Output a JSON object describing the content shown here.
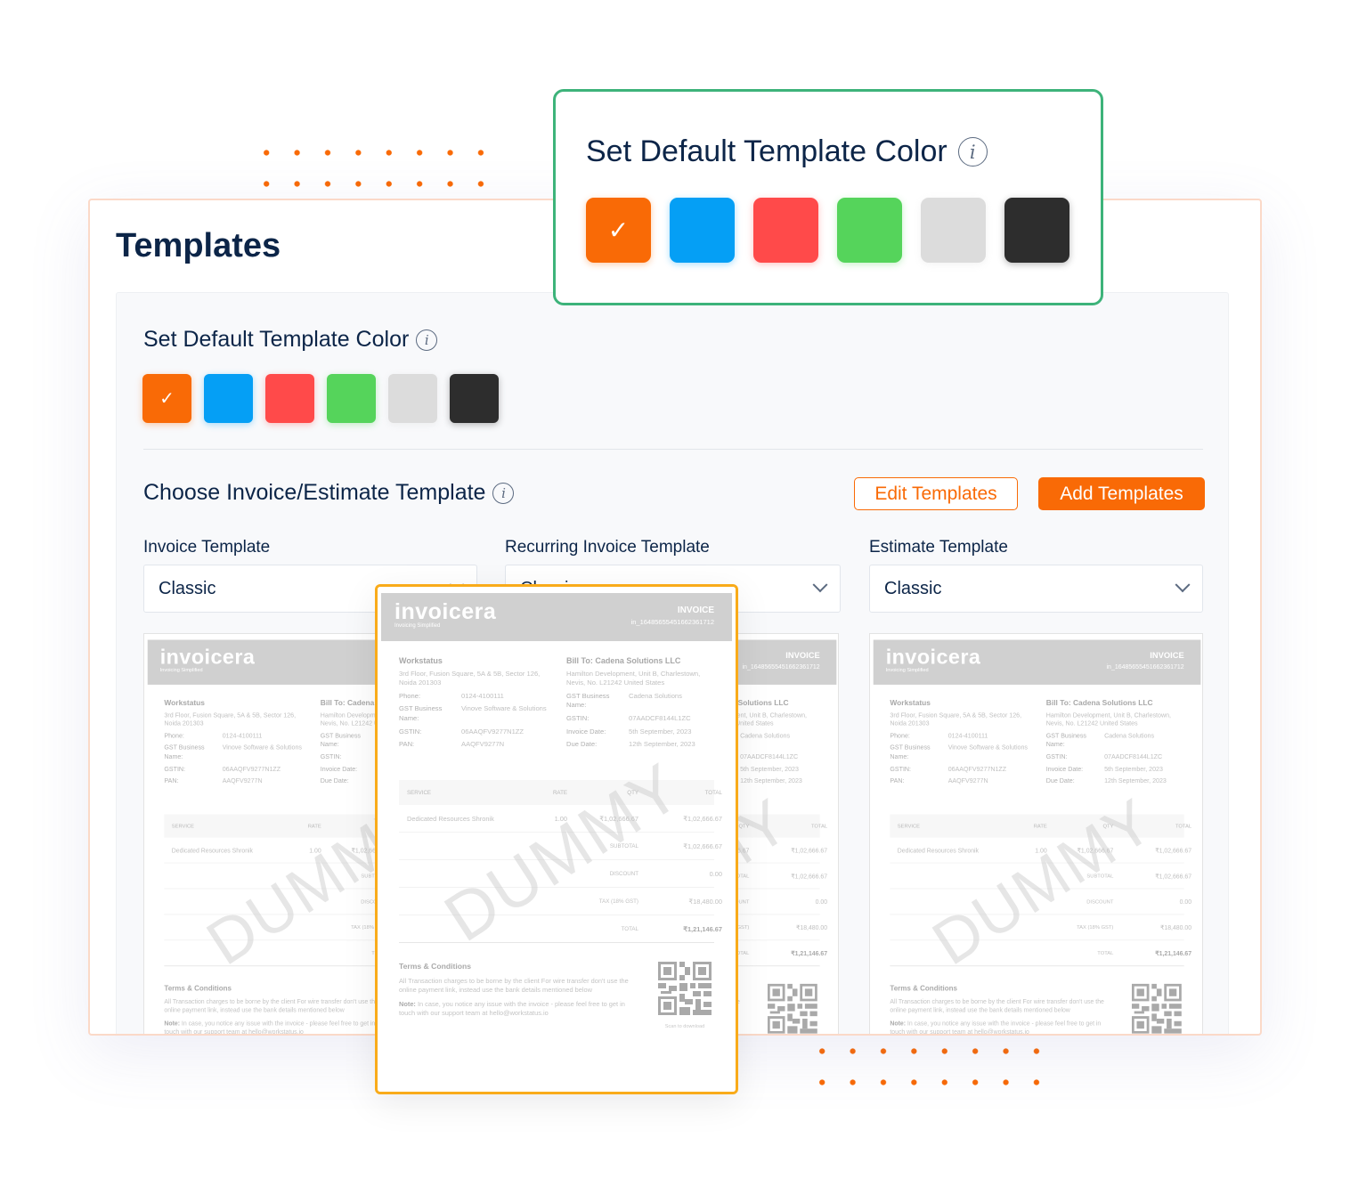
{
  "colors": {
    "accent": "#f96a06",
    "popup_border": "#3db37a",
    "highlight_border": "#f9ab1a",
    "navy": "#0c2548"
  },
  "popup": {
    "title": "Set Default Template Color",
    "info_icon": "i"
  },
  "page": {
    "title": "Templates"
  },
  "color_section": {
    "title": "Set Default Template Color",
    "info_icon": "i",
    "swatches": [
      {
        "name": "orange",
        "hex": "#f96a06",
        "selected": true
      },
      {
        "name": "blue",
        "hex": "#059ff5",
        "selected": false
      },
      {
        "name": "red",
        "hex": "#ff4a4a",
        "selected": false
      },
      {
        "name": "green",
        "hex": "#55d45b",
        "selected": false
      },
      {
        "name": "light-gray",
        "hex": "#dcdcdc",
        "selected": false
      },
      {
        "name": "dark",
        "hex": "#2d2d2d",
        "selected": false
      }
    ],
    "check": "✓"
  },
  "choose": {
    "title": "Choose Invoice/Estimate Template",
    "info_icon": "i",
    "edit_label": "Edit Templates",
    "add_label": "Add Templates"
  },
  "selects": [
    {
      "label": "Invoice Template",
      "value": "Classic"
    },
    {
      "label": "Recurring Invoice Template",
      "value": "Classic"
    },
    {
      "label": "Estimate Template",
      "value": "Classic"
    }
  ],
  "invoice": {
    "brand": "invoicera",
    "tagline": "Invoicing Simplified",
    "doc_type": "INVOICE",
    "number": "in_1648565545166236171​2",
    "from": {
      "name": "Workstatus",
      "address": "3rd Floor, Fusion Square, 5A & 5B, Sector 126, Noida 201303",
      "fields": [
        {
          "label": "Phone:",
          "value": "0124-4100111"
        },
        {
          "label": "GST Business Name:",
          "value": "Vinove Software & Solutions"
        },
        {
          "label": "GSTIN:",
          "value": "06AAQFV9277N1ZZ"
        },
        {
          "label": "PAN:",
          "value": "AAQFV9277N"
        }
      ]
    },
    "bill_to": {
      "name": "Bill To: Cadena Solutions LLC",
      "address": "Hamilton Development, Unit B, Charlestown, Nevis, No. L21242 United States",
      "fields": [
        {
          "label": "GST Business Name:",
          "value": "Cadena Solutions"
        },
        {
          "label": "GSTIN:",
          "value": "07AADCF8144L1ZC"
        },
        {
          "label": "Invoice Date:",
          "value": "5th September, 2023"
        },
        {
          "label": "Due Date:",
          "value": "12th September, 2023"
        }
      ]
    },
    "table": {
      "headers": [
        "SERVICE",
        "RATE",
        "QTY",
        "TOTAL"
      ],
      "row": {
        "service": "Dedicated Resources Shronik",
        "rate": "1.00",
        "qty": "₹1,02,666.67",
        "total": "₹1,02,666.67"
      },
      "subtotal": {
        "label": "SUBTOTAL",
        "value": "₹1,02,666.67"
      },
      "discount": {
        "label": "DISCOUNT",
        "value": "0.00"
      },
      "tax": {
        "label": "TAX (18% GST)",
        "value": "₹18,480.00"
      },
      "total": {
        "label": "TOTAL",
        "value": "₹1,21,146.67"
      }
    },
    "terms": {
      "title": "Terms & Conditions",
      "text": "All Transaction charges to be borne by the client For wire transfer don't use the online payment link, instead use the bank details mentioned below",
      "note_label": "Note:",
      "note": " In case, you notice any issue with the invoice - please feel free to get in touch with our support team at hello@workstatus.io"
    },
    "qr_caption": "Scan to download",
    "watermark": "DUMMY"
  }
}
